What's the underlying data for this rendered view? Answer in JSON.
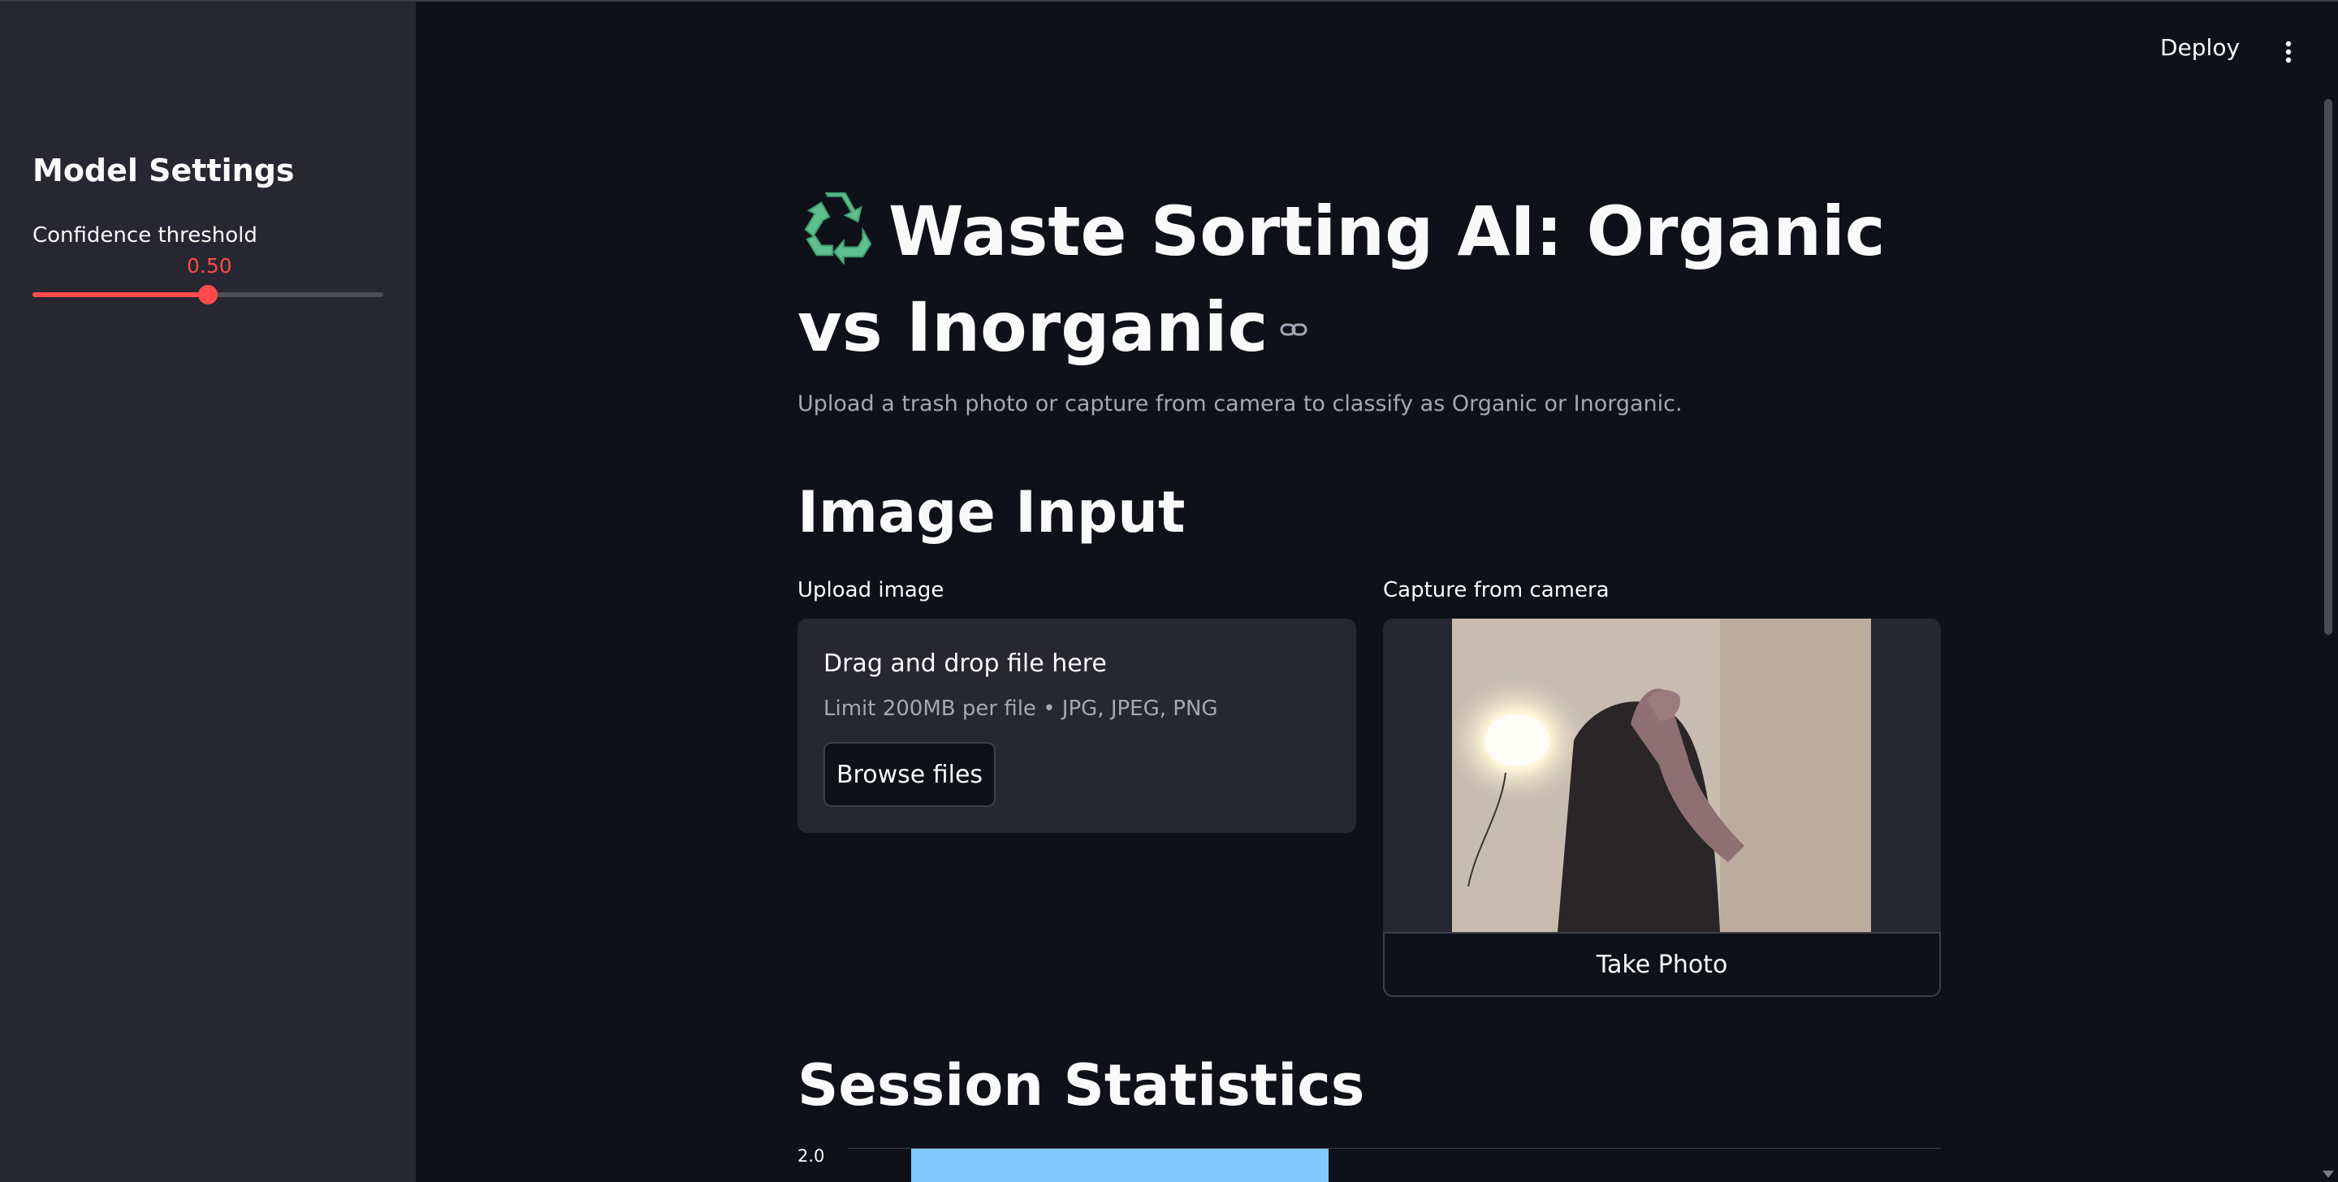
{
  "header": {
    "deploy_label": "Deploy",
    "menu_icon": "vertical-ellipsis-icon"
  },
  "sidebar": {
    "title": "Model Settings",
    "slider": {
      "label": "Confidence threshold",
      "value_text": "0.50",
      "value": 0.5,
      "min": 0,
      "max": 1,
      "accent_color": "#ff4b4b"
    }
  },
  "main": {
    "title_icon": "recycle-icon",
    "title": "Waste Sorting AI: Organic vs Inorganic",
    "caption": "Upload a trash photo or capture from camera to classify as Organic or Inorganic.",
    "image_input": {
      "heading": "Image Input",
      "upload": {
        "label": "Upload image",
        "dropzone_title": "Drag and drop file here",
        "dropzone_limit": "Limit 200MB per file • JPG, JPEG, PNG",
        "browse_label": "Browse files"
      },
      "camera": {
        "label": "Capture from camera",
        "take_photo_label": "Take Photo"
      }
    },
    "session_statistics": {
      "heading": "Session Statistics"
    }
  },
  "chart_data": {
    "type": "bar",
    "visible_y_ticks": [
      "2.0"
    ],
    "values": [
      2.0
    ],
    "bar_color": "#83c9ff",
    "grid": true
  },
  "colors": {
    "background": "#0e1117",
    "sidebar": "#262730",
    "accent": "#ff4b4b",
    "muted_text": "#a3a8b8"
  }
}
